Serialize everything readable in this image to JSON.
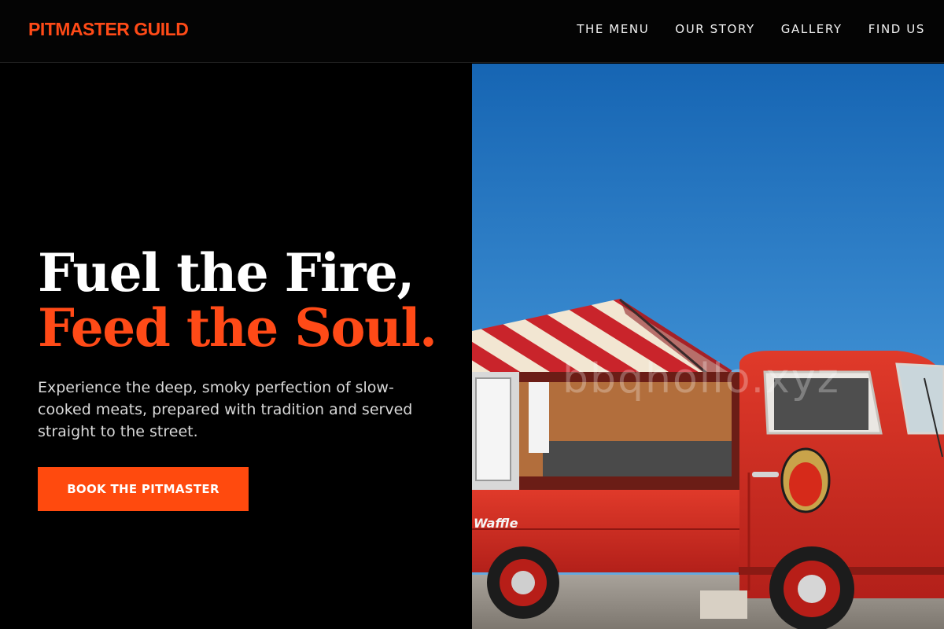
{
  "brand": {
    "name": "PITMASTER GUILD",
    "color": "#ff4a17"
  },
  "nav": {
    "items": [
      {
        "label": "THE MENU"
      },
      {
        "label": "OUR STORY"
      },
      {
        "label": "GALLERY"
      },
      {
        "label": "FIND US"
      }
    ]
  },
  "hero": {
    "headline_line1": "Fuel the Fire,",
    "headline_line2": "Feed the Soul.",
    "tagline": "Experience the deep, smoky perfection of slow-cooked meats, prepared with tradition and served straight to the street.",
    "cta_label": "BOOK THE PITMASTER",
    "accent_color": "#ff4a17"
  },
  "photo": {
    "subject": "red vintage food truck with striped awning under blue sky",
    "watermark": "bbqhollo.xyz",
    "truck_sign": "Waffle"
  }
}
